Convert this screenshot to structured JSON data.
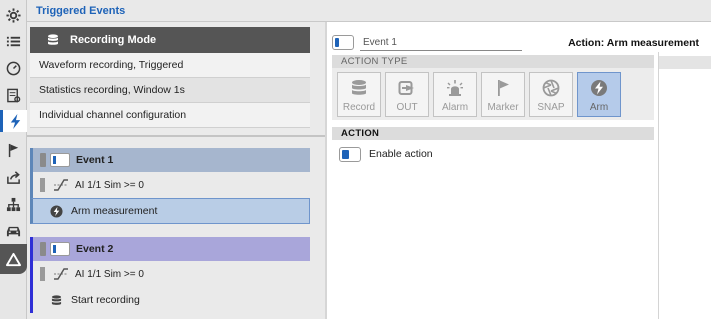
{
  "window": {
    "title": "Triggered Events"
  },
  "rail": {
    "items": [
      {
        "icon": "gear-icon"
      },
      {
        "icon": "list-icon"
      },
      {
        "icon": "gauge-icon"
      },
      {
        "icon": "report-icon"
      },
      {
        "icon": "lightning-icon",
        "active": true
      },
      {
        "icon": "flag-icon"
      },
      {
        "icon": "export-icon"
      },
      {
        "icon": "network-icon"
      },
      {
        "icon": "car-icon"
      },
      {
        "icon": "triangle-icon"
      }
    ]
  },
  "recording": {
    "header": "Recording Mode",
    "modes": [
      {
        "label": "Waveform recording, Triggered"
      },
      {
        "label": "Statistics recording, Window 1s",
        "selected": true
      },
      {
        "label": "Individual channel configuration"
      }
    ]
  },
  "events": [
    {
      "title": "Event 1",
      "condition": "AI 1/1 Sim >= 0",
      "action": "Arm measurement",
      "colors": {
        "head": "#a6b6ce",
        "accent": "#5d86b8",
        "action_bg": "#b9cde6"
      }
    },
    {
      "title": "Event 2",
      "condition": "AI 1/1 Sim >= 0",
      "action": "Start recording",
      "colors": {
        "head": "#a9a6da",
        "accent": "#2f2fd6",
        "action_bg": "#eaeaea"
      }
    }
  ],
  "detail": {
    "name_value": "Event 1",
    "action_title": "Action: Arm measurement",
    "action_type_header": "ACTION TYPE",
    "action_types": [
      {
        "label": "Record",
        "icon": "database-icon"
      },
      {
        "label": "OUT",
        "icon": "output-icon"
      },
      {
        "label": "Alarm",
        "icon": "alarm-icon"
      },
      {
        "label": "Marker",
        "icon": "flag-icon"
      },
      {
        "label": "SNAP",
        "icon": "shutter-icon"
      },
      {
        "label": "Arm",
        "icon": "lightning-icon",
        "active": true
      }
    ],
    "action_header": "ACTION",
    "enable_label": "Enable action",
    "enable_on": true
  },
  "colors": {
    "accent": "#1e63b8",
    "rail_bg": "#e6e6e6",
    "header_dark": "#555555"
  }
}
